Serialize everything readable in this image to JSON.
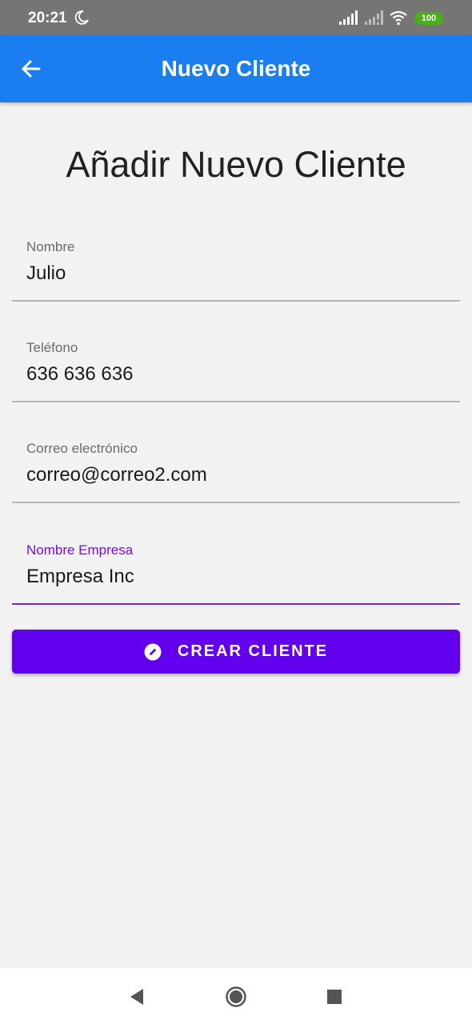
{
  "status_bar": {
    "time": "20:21",
    "battery": "100",
    "battery_color": "#4caf1a",
    "icons": [
      "moon-icon",
      "signal-icon",
      "signal-off-icon",
      "wifi-icon",
      "battery-icon"
    ]
  },
  "app_bar": {
    "title": "Nuevo Cliente",
    "back_icon": "arrow-back-icon",
    "color": "#1b7ef0"
  },
  "form": {
    "heading": "Añadir Nuevo Cliente",
    "fields": [
      {
        "label": "Nombre",
        "value": "Julio"
      },
      {
        "label": "Teléfono",
        "value": "636 636 636"
      },
      {
        "label": "Correo electrónico",
        "value": "correo@correo2.com"
      },
      {
        "label": "Nombre Empresa",
        "value": "Empresa Inc",
        "focused": true
      }
    ],
    "focus_color": "#7a0fd0",
    "submit_label": "CREAR CLIENTE",
    "submit_icon": "edit-icon",
    "submit_color": "#6200ee"
  },
  "nav_bar": {
    "icons": [
      "nav-back-icon",
      "nav-home-icon",
      "nav-recent-icon"
    ]
  }
}
